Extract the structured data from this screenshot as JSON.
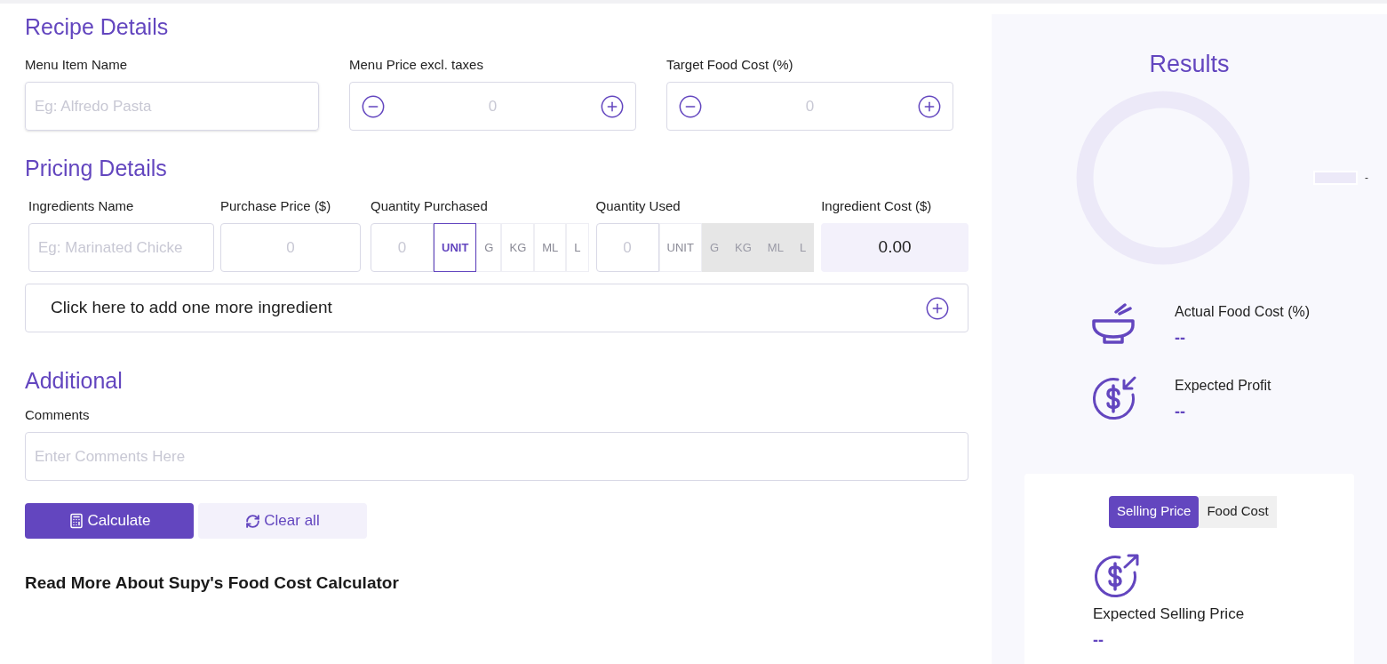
{
  "recipe": {
    "title": "Recipe Details",
    "name_field": {
      "label": "Menu Item Name",
      "placeholder": "Eg: Alfredo Pasta"
    },
    "steppers": [
      {
        "label": "Menu Price excl. taxes",
        "placeholder": "0"
      },
      {
        "label": "Target Food Cost (%)",
        "placeholder": "0"
      }
    ]
  },
  "pricing": {
    "title": "Pricing Details",
    "ingredient_name": {
      "label": "Ingredients Name",
      "placeholder": "Eg: Marinated Chicke"
    },
    "purchase_price": {
      "label": "Purchase Price ($)",
      "placeholder": "0"
    },
    "quantity_purchased": {
      "label": "Quantity Purchased",
      "placeholder": "0",
      "units": [
        {
          "label": "UNIT",
          "selected": true,
          "disabled": false
        },
        {
          "label": "G",
          "selected": false,
          "disabled": false
        },
        {
          "label": "KG",
          "selected": false,
          "disabled": false
        },
        {
          "label": "ML",
          "selected": false,
          "disabled": false
        },
        {
          "label": "L",
          "selected": false,
          "disabled": false
        }
      ]
    },
    "quantity_used": {
      "label": "Quantity Used",
      "placeholder": "0",
      "units": [
        {
          "label": "UNIT",
          "selected": false,
          "disabled": false
        },
        {
          "label": "G",
          "selected": false,
          "disabled": true
        },
        {
          "label": "KG",
          "selected": false,
          "disabled": true
        },
        {
          "label": "ML",
          "selected": false,
          "disabled": true
        },
        {
          "label": "L",
          "selected": false,
          "disabled": true
        }
      ]
    },
    "ingredient_cost": {
      "label": "Ingredient Cost ($)",
      "value": "0.00"
    },
    "add_ingredient": "Click here to add one more ingredient"
  },
  "additional": {
    "title": "Additional",
    "comments": {
      "label": "Comments",
      "placeholder": "Enter Comments Here"
    }
  },
  "buttons": {
    "calculate": "Calculate",
    "clear": "Clear all"
  },
  "read_more": "Read More About Supy's Food Cost Calculator",
  "results": {
    "title": "Results",
    "legend": "-",
    "metrics": [
      {
        "kind": "bowl",
        "label": "Actual Food Cost (%)",
        "value": "--"
      },
      {
        "kind": "profit",
        "label": "Expected Profit",
        "value": "--"
      }
    ],
    "tabs": [
      {
        "label": "Selling Price",
        "selected": true
      },
      {
        "label": "Food Cost",
        "selected": false
      }
    ],
    "selling": {
      "label": "Expected Selling Price",
      "value": "--"
    }
  }
}
